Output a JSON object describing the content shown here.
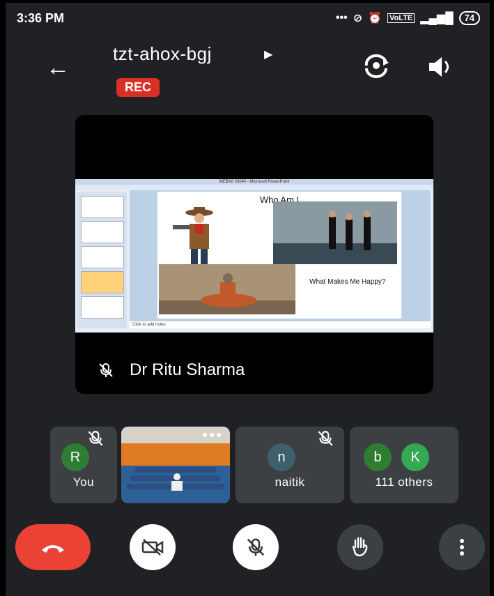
{
  "status_bar": {
    "time": "3:36 PM",
    "icons": [
      "more-dots-icon",
      "sync-off-icon",
      "alarm-icon",
      "volte-icon",
      "signal-4g-icon"
    ],
    "battery": "74"
  },
  "header": {
    "meeting_code": "tzt-ahox-bgj",
    "rec_label": "REC",
    "icons": [
      "back-arrow-icon",
      "play-triangle-icon",
      "flip-camera-icon",
      "speaker-icon"
    ]
  },
  "presenter": {
    "name": "Dr Ritu Sharma",
    "muted": true,
    "shared_screen": {
      "app_title": "MEBA0 03040 - Microsoft PowerPoint",
      "slide_title": "Who Am I",
      "slide_text": "What Makes Me Happy?",
      "notes_placeholder": "Click to add notes"
    }
  },
  "participants": [
    {
      "initial": "R",
      "name": "You",
      "muted": true
    },
    {
      "initial": "",
      "name": "",
      "video": true
    },
    {
      "initial": "n",
      "name": "naitik",
      "muted": true
    },
    {
      "initials": [
        "b",
        "K"
      ],
      "name": "111 others"
    }
  ],
  "colors": {
    "background": "#202124",
    "tile": "#3c4043",
    "rec": "#d93025",
    "end_call": "#ea4335",
    "avatar_green": "#2e7d32",
    "avatar_green_light": "#34a853",
    "avatar_slate": "#3f5e6e"
  },
  "controls": {
    "icons": [
      "end-call-icon",
      "camera-off-icon",
      "mic-off-icon",
      "raise-hand-icon",
      "more-vert-icon"
    ]
  }
}
